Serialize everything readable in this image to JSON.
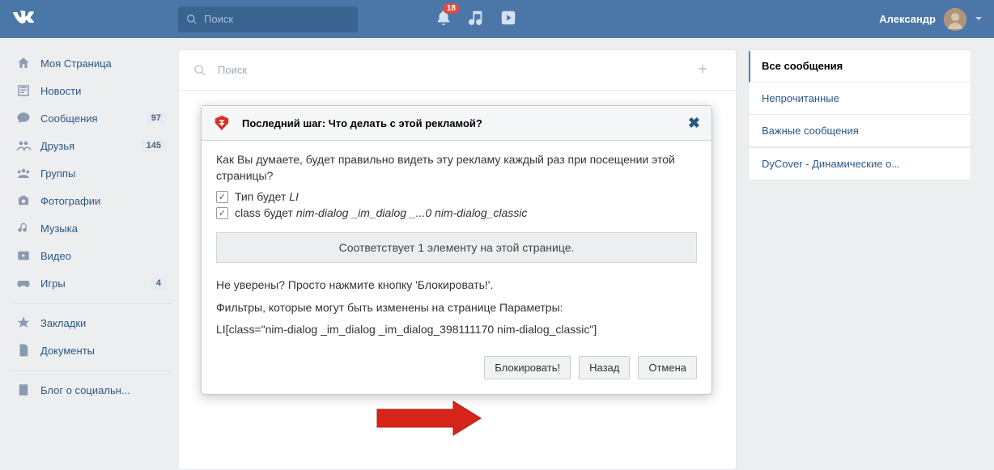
{
  "header": {
    "search_placeholder": "Поиск",
    "notification_count": "18",
    "username": "Александр"
  },
  "sidebar": {
    "items": [
      {
        "label": "Моя Страница"
      },
      {
        "label": "Новости"
      },
      {
        "label": "Сообщения",
        "badge": "97"
      },
      {
        "label": "Друзья",
        "badge": "145"
      },
      {
        "label": "Группы"
      },
      {
        "label": "Фотографии"
      },
      {
        "label": "Музыка"
      },
      {
        "label": "Видео"
      },
      {
        "label": "Игры",
        "badge": "4"
      }
    ],
    "items2": [
      {
        "label": "Закладки"
      },
      {
        "label": "Документы"
      }
    ],
    "items3": [
      {
        "label": "Блог о социальн..."
      }
    ]
  },
  "center": {
    "search_placeholder": "Поиск"
  },
  "right_tabs": {
    "active": "Все сообщения",
    "items": [
      "Непрочитанные",
      "Важные сообщения"
    ],
    "footer": "DyCover - Динамические о..."
  },
  "dialog": {
    "title": "Последний шаг: Что делать с этой рекламой?",
    "intro": "Как Вы думаете, будет правильно видеть эту рекламу каждый раз при посещении этой страницы?",
    "check1_prefix": "Тип будет ",
    "check1_em": "LI",
    "check2_prefix": "class будет ",
    "check2_em": "nim-dialog _im_dialog _...0 nim-dialog_classic",
    "match": "Соответствует 1 элементу на этой странице.",
    "unsure": "Не уверены? Просто нажмите кнопку 'Блокировать!'.",
    "filters_line1": "Фильтры, которые могут быть изменены на странице Параметры:",
    "filters_line2": "LI[class=\"nim-dialog _im_dialog _im_dialog_398111170 nim-dialog_classic\"]",
    "btn_block": "Блокировать!",
    "btn_back": "Назад",
    "btn_cancel": "Отмена"
  }
}
